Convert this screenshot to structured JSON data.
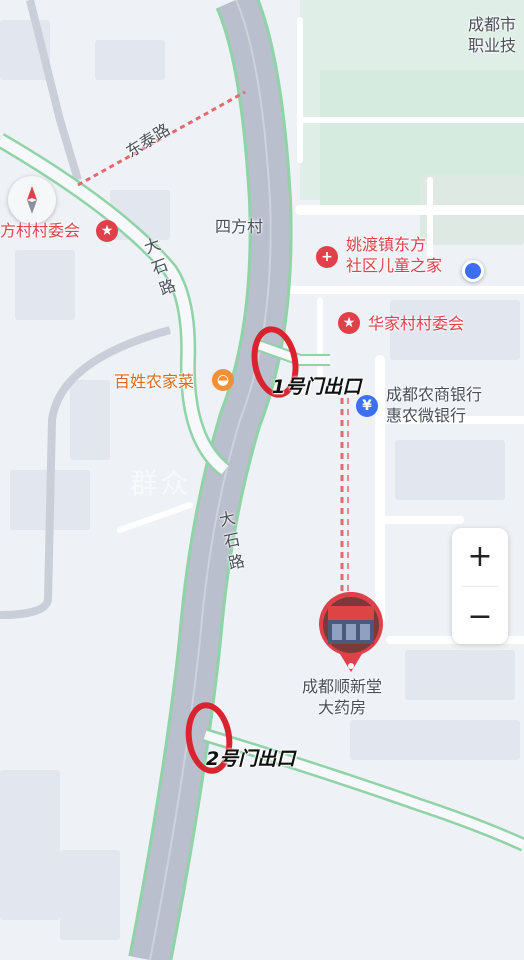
{
  "map": {
    "places": {
      "chengdu_vocational": "成都市\n职业技",
      "village_committee_west": "方村村委会",
      "sifangcun": "四方村",
      "yaodu_community": "姚渡镇东方\n社区儿童之家",
      "huajia_committee": "华家村村委会",
      "baixing_restaurant": "百姓农家菜",
      "bank": "成都农商银行\n惠农微银行",
      "pharmacy": "成都顺新堂\n大药房"
    },
    "roads": {
      "dongtai": "东泰路",
      "dashi_upper": "大石路",
      "dashi_lower": "大石路"
    },
    "exits": {
      "exit1": "1号门出口",
      "exit2": "2号门出口"
    },
    "watermark": "群众",
    "controls": {
      "zoom_in": "+",
      "zoom_out": "−"
    }
  },
  "colors": {
    "main_road": "#b9bfcc",
    "road_edge": "#8fd3a6",
    "street": "#ffffff",
    "block": "#e2e6ee",
    "green_area": "#dcefe4",
    "red_marker": "#d9232e",
    "route_dash": "#e46a6f"
  },
  "icons": {
    "compass": "compass-icon",
    "hospital": "plus-icon",
    "committee": "star-icon",
    "restaurant": "bowl-icon",
    "bank": "yen-icon",
    "location": "location-dot-icon"
  }
}
